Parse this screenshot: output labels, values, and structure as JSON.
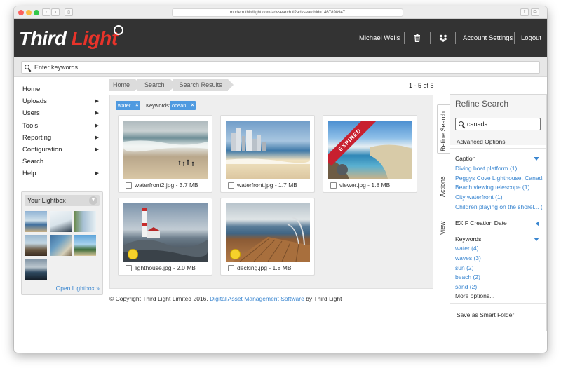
{
  "browser": {
    "url": "modern.thirdlight.com/advsearch.tl?advsearchid=1467898947"
  },
  "header": {
    "logo_white": "Third ",
    "logo_red": "Light",
    "user_name": "Michael Wells",
    "account_settings": "Account Settings",
    "logout": "Logout",
    "icons": [
      "trash-icon",
      "dropbox-icon"
    ]
  },
  "search": {
    "placeholder": "Enter keywords..."
  },
  "nav": {
    "items": [
      {
        "label": "Home",
        "has_sub": false
      },
      {
        "label": "Uploads",
        "has_sub": true
      },
      {
        "label": "Users",
        "has_sub": true
      },
      {
        "label": "Tools",
        "has_sub": true
      },
      {
        "label": "Reporting",
        "has_sub": true
      },
      {
        "label": "Configuration",
        "has_sub": true
      },
      {
        "label": "Search",
        "has_sub": false
      },
      {
        "label": "Help",
        "has_sub": true
      }
    ],
    "arrow": "▶"
  },
  "lightbox": {
    "title": "Your Lightbox",
    "open_link": "Open Lightbox »"
  },
  "breadcrumb": {
    "items": [
      "Home",
      "Search",
      "Search Results"
    ]
  },
  "results": {
    "count": "1 - 5 of 5",
    "keywords_label": "Keywords:",
    "tags": [
      {
        "label": "water"
      },
      {
        "label": "ocean"
      }
    ],
    "tag_remove": "×",
    "files": [
      {
        "caption": "waterfront2.jpg - 3.7 MB"
      },
      {
        "caption": "waterfront.jpg - 1.7 MB"
      },
      {
        "caption": "viewer.jpg - 1.8 MB",
        "badge": "EXPIRED"
      },
      {
        "caption": "lighthouse.jpg - 2.0 MB"
      },
      {
        "caption": "decking.jpg - 1.8 MB"
      }
    ]
  },
  "footer": {
    "prefix": "© Copyright Third Light Limited 2016.",
    "link": "Digital Asset Management Software",
    "suffix": "by Third Light"
  },
  "side_tabs": {
    "refine": "Refine Search",
    "actions": "Actions",
    "view": "View"
  },
  "refine": {
    "title": "Refine Search",
    "search_value": "canada",
    "advanced": "Advanced Options",
    "caption_head": "Caption",
    "caption_items": [
      "Diving boat platform (1)",
      "Peggys Cove Lighthouse, Canada",
      "Beach viewing telescope (1)",
      "City waterfront (1)",
      "Children playing on the shorel... (1)"
    ],
    "exif_head": "EXIF Creation Date",
    "keywords_head": "Keywords",
    "keyword_items": [
      "water (4)",
      "waves (3)",
      "sun (2)",
      "beach (2)",
      "sand (2)"
    ],
    "more": "More options...",
    "smart_folder": "Save as Smart Folder"
  }
}
